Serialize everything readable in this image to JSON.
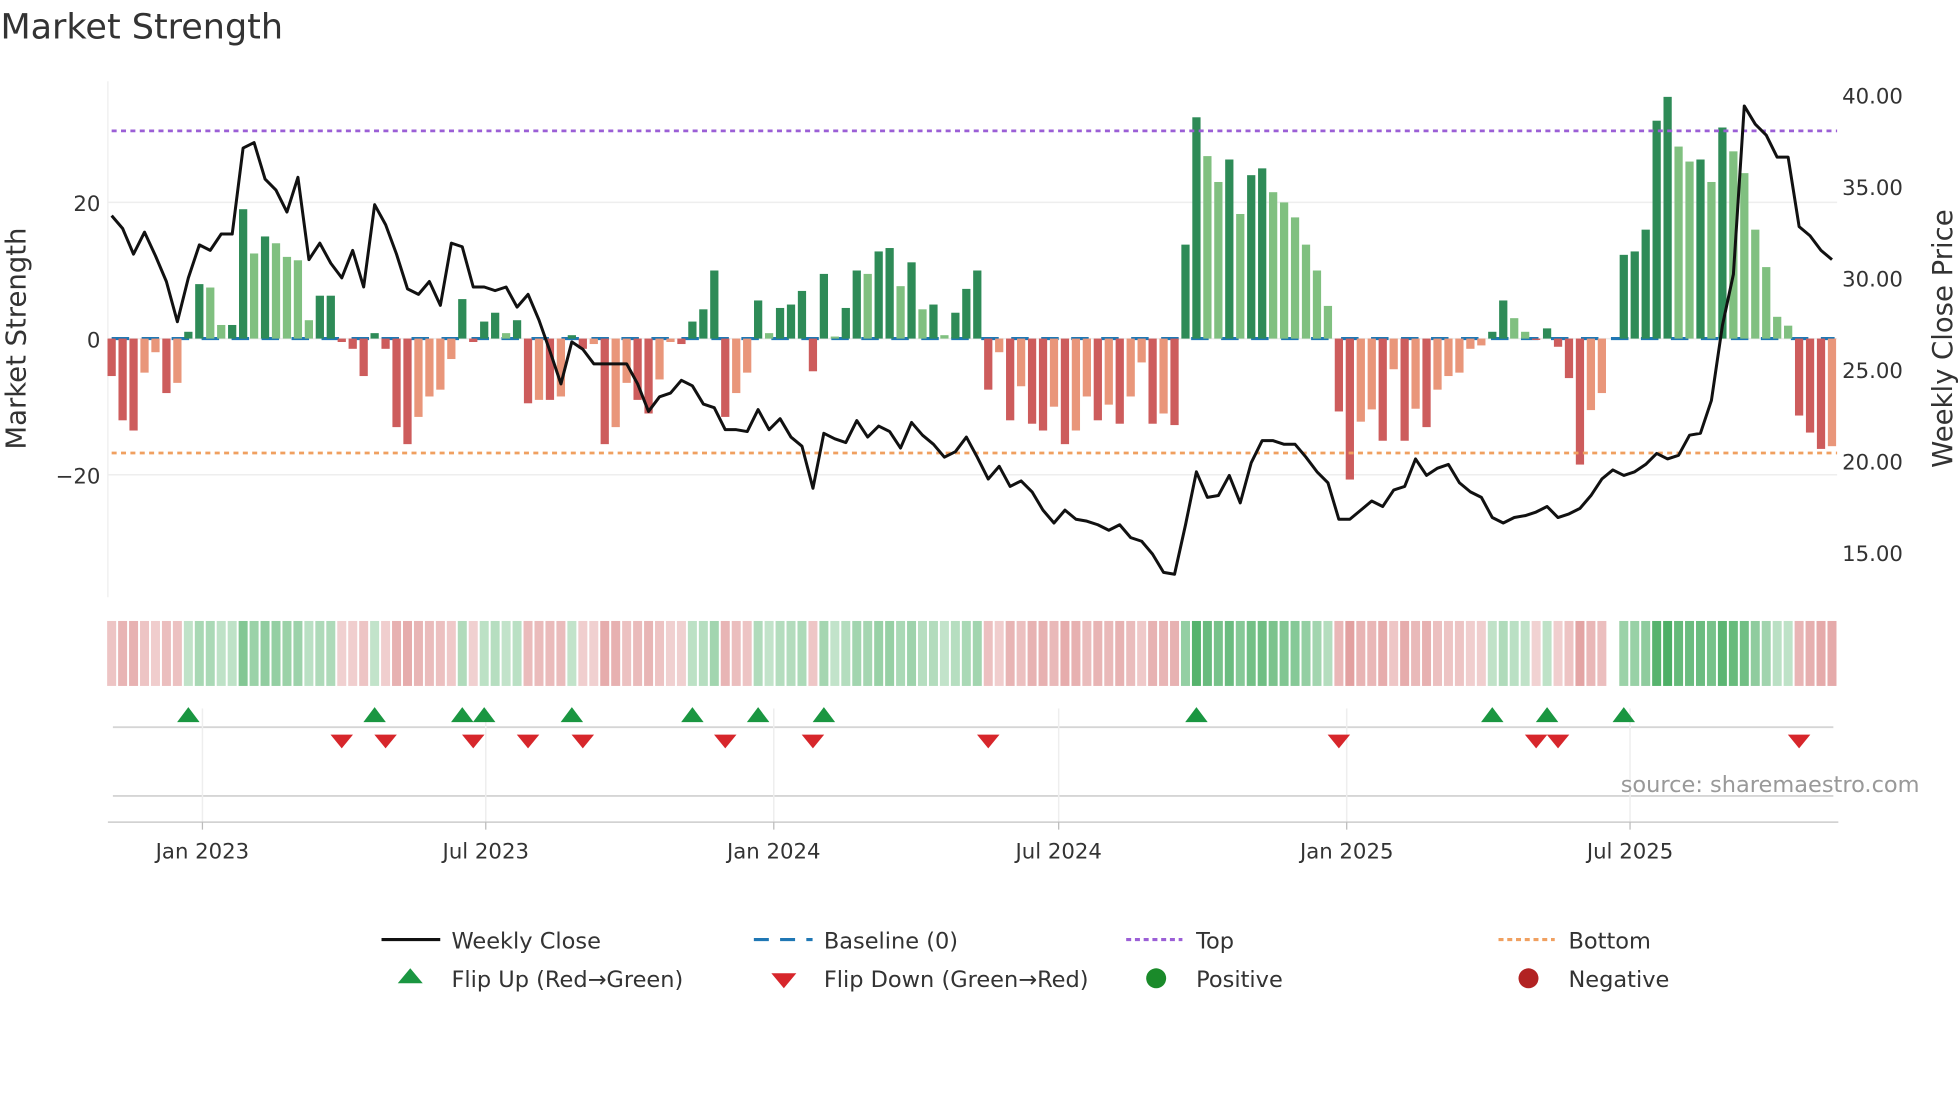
{
  "title": "Market Strength",
  "source": "source: sharemaestro.com",
  "legend": {
    "weekly_close": "Weekly Close",
    "baseline": "Baseline (0)",
    "top": "Top",
    "bottom": "Bottom",
    "flip_up": "Flip Up (Red→Green)",
    "flip_down": "Flip Down (Green→Red)",
    "positive": "Positive",
    "negative": "Negative"
  },
  "colors": {
    "pos_dark": "#2e8b57",
    "pos_light": "#80c080",
    "neg_dark": "#cd5c5c",
    "neg_light": "#e9967a",
    "baseline": "#1f77b4",
    "top": "#9b5fd6",
    "bottom": "#f0a060",
    "flip_up": "#1a9641",
    "flip_down": "#d7262b",
    "positive": "#1a8a2a",
    "negative": "#b22222",
    "close": "#111111"
  },
  "chart_data": {
    "type": "bar+line",
    "title": "Market Strength",
    "ylabel": "Market Strength",
    "y2label": "Weekly Close Price",
    "ylim": [
      -38,
      38
    ],
    "y2lim": [
      12.9,
      40.7
    ],
    "yticks": [
      20,
      0,
      -20
    ],
    "ytick_labels": [
      "20",
      "0",
      "−20"
    ],
    "y2ticks": [
      40,
      35,
      30,
      25,
      20,
      15
    ],
    "y2tick_labels": [
      "40.00",
      "35.00",
      "30.00",
      "25.00",
      "20.00",
      "15.00"
    ],
    "start_date": "2022-11-04",
    "frequency": "weekly",
    "xticks": [
      {
        "date": "2023-01-01",
        "label": "Jan 2023"
      },
      {
        "date": "2023-07-01",
        "label": "Jul 2023"
      },
      {
        "date": "2024-01-01",
        "label": "Jan 2024"
      },
      {
        "date": "2024-07-01",
        "label": "Jul 2024"
      },
      {
        "date": "2025-01-01",
        "label": "Jan 2025"
      },
      {
        "date": "2025-07-01",
        "label": "Jul 2025"
      }
    ],
    "top_level": 30.5,
    "bottom_level": -16.8,
    "baseline": 0,
    "strength": [
      -5.5,
      -12,
      -13.5,
      -5,
      -2,
      -8,
      -6.5,
      1,
      8,
      7.5,
      2,
      2,
      19,
      12.5,
      15,
      14,
      12,
      11.5,
      2.7,
      6.3,
      6.3,
      -0.5,
      -1.5,
      -5.5,
      0.8,
      -1.5,
      -13,
      -15.5,
      -11.5,
      -8.5,
      -7.5,
      -3,
      5.8,
      -0.5,
      2.5,
      3.8,
      0.8,
      2.7,
      -9.5,
      -9,
      -9,
      -8.5,
      0.5,
      -1.5,
      -0.8,
      -15.5,
      -13,
      -6.5,
      -9,
      -11,
      -6,
      -0.5,
      -0.8,
      2.5,
      4.3,
      10,
      -11.5,
      -8,
      -5,
      5.6,
      0.8,
      4.5,
      5,
      7,
      -4.8,
      9.5,
      0.3,
      4.5,
      10,
      9.5,
      12.8,
      13.3,
      7.7,
      11.2,
      4.3,
      5,
      0.5,
      3.8,
      7.3,
      10,
      -7.5,
      -2,
      -12,
      -7,
      -12.5,
      -13.5,
      -10,
      -15.5,
      -13.5,
      -8.5,
      -12,
      -9.7,
      -12.5,
      -8.5,
      -3.5,
      -12.5,
      -11,
      -12.7,
      13.8,
      32.5,
      26.8,
      23,
      26.3,
      18.3,
      24,
      25,
      21.5,
      20,
      17.8,
      13.8,
      10,
      4.8,
      -10.7,
      -20.7,
      -12.2,
      -10.4,
      -15,
      -4.5,
      -15,
      -10.3,
      -13,
      -7.5,
      -5.5,
      -5,
      -1.5,
      -1,
      1,
      5.6,
      3,
      1,
      -0.2,
      1.5,
      -1.2,
      -5.8,
      -18.5,
      -10.5,
      -8,
      0,
      12.3,
      12.8,
      16,
      32,
      35.5,
      28.2,
      26,
      26.3,
      23,
      31,
      27.5,
      24.3,
      16,
      10.5,
      3.2,
      1.9,
      -11.3,
      -13.8,
      -16.2,
      -15.8
    ],
    "close": [
      33.4,
      32.7,
      31.3,
      32.5,
      31.2,
      29.8,
      27.6,
      30.0,
      31.8,
      31.5,
      32.4,
      32.4,
      37.1,
      37.4,
      35.4,
      34.8,
      33.6,
      35.5,
      31.0,
      31.9,
      30.8,
      30.0,
      31.5,
      29.5,
      34.0,
      32.9,
      31.3,
      29.4,
      29.1,
      29.8,
      28.5,
      31.9,
      31.7,
      29.5,
      29.5,
      29.3,
      29.5,
      28.4,
      29.1,
      27.7,
      26.0,
      24.2,
      26.5,
      26.1,
      25.3,
      25.3,
      25.3,
      25.3,
      24.2,
      22.7,
      23.5,
      23.7,
      24.4,
      24.1,
      23.1,
      22.9,
      21.7,
      21.7,
      21.6,
      22.8,
      21.7,
      22.3,
      21.3,
      20.8,
      18.5,
      21.5,
      21.2,
      21.0,
      22.2,
      21.3,
      21.9,
      21.6,
      20.7,
      22.1,
      21.4,
      20.9,
      20.2,
      20.5,
      21.3,
      20.2,
      19.0,
      19.7,
      18.6,
      18.9,
      18.3,
      17.3,
      16.6,
      17.3,
      16.8,
      16.7,
      16.5,
      16.2,
      16.5,
      15.8,
      15.6,
      14.9,
      13.9,
      13.8,
      16.5,
      19.4,
      18.0,
      18.1,
      19.2,
      17.7,
      19.9,
      21.1,
      21.1,
      20.9,
      20.9,
      20.2,
      19.4,
      18.8,
      16.8,
      16.8,
      17.3,
      17.8,
      17.5,
      18.4,
      18.6,
      20.1,
      19.2,
      19.6,
      19.8,
      18.8,
      18.3,
      18.0,
      16.9,
      16.6,
      16.9,
      17.0,
      17.2,
      17.5,
      16.9,
      17.1,
      17.4,
      18.1,
      19.0,
      19.5,
      19.2,
      19.4,
      19.8,
      20.4,
      20.1,
      20.3,
      21.4,
      21.5,
      23.3,
      27.4,
      30.2,
      39.4,
      38.4,
      37.8,
      36.6,
      36.6,
      32.8,
      32.3,
      31.5,
      31.0
    ],
    "flip_up_weeks": [
      7,
      24,
      32,
      34,
      42,
      53,
      59,
      65,
      99,
      126,
      131,
      138
    ],
    "flip_down_weeks": [
      21,
      25,
      33,
      38,
      43,
      56,
      64,
      80,
      112,
      130,
      132,
      154
    ]
  }
}
